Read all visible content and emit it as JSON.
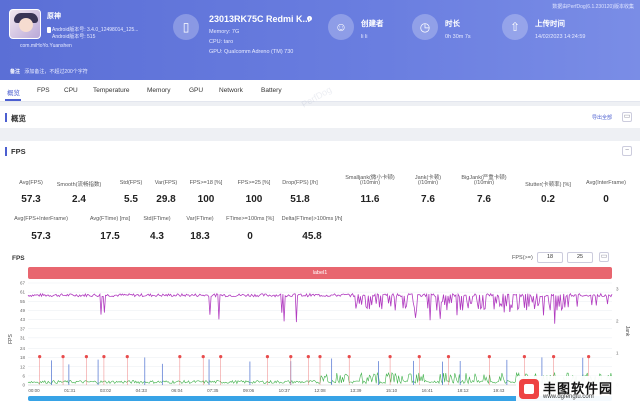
{
  "header": {
    "note": "数据由PerfDog(6.1.230120)版本收集",
    "app": {
      "name": "原神",
      "android_line1": "Android版本号: 3.4.0_12498014_125...",
      "android_line2": "Android版本号: 515",
      "package": "com.miHoYo.Yuanshen"
    },
    "remark_label": "备注",
    "remark_placeholder": "添加备注，不超过200个字符",
    "device": {
      "name": "23013RK75C Redmi K...",
      "memory": "Memory: 7G",
      "cpu": "CPU: taro",
      "gpu": "GPU: Qualcomm Adreno (TM) 730"
    },
    "creator": {
      "title": "创建者",
      "value": "li li"
    },
    "duration": {
      "title": "时长",
      "value": "0h 30m 7s"
    },
    "upload": {
      "title": "上传时间",
      "value": "14/02/2023 14:24:59"
    },
    "icons": {
      "phone": "phone-icon",
      "user": "user-icon",
      "clock": "clock-icon",
      "upload": "upload-icon"
    }
  },
  "tabs": [
    "概览",
    "FPS",
    "CPU",
    "Temperature",
    "Memory",
    "GPU",
    "Network",
    "Battery"
  ],
  "overview": {
    "title": "概览",
    "export": "导出全部"
  },
  "fps": {
    "title": "FPS",
    "stats_row1": [
      {
        "label": "Avg(FPS)",
        "value": "57.3"
      },
      {
        "label": "Smooth(流畅指数)",
        "value": "2.4"
      },
      {
        "label": "Std(FPS)",
        "value": "5.5"
      },
      {
        "label": "Var(FPS)",
        "value": "29.8"
      },
      {
        "label": "FPS>=18 [%]",
        "value": "100"
      },
      {
        "label": "FPS>=25 [%]",
        "value": "100"
      },
      {
        "label": "Drop(FPS) [/h]",
        "value": "51.8"
      },
      {
        "label": "Smalljank(微小卡顿)",
        "label2": "(/10min)",
        "value": "11.6"
      },
      {
        "label": "Jank(卡顿)",
        "label2": "(/10min)",
        "value": "7.6"
      },
      {
        "label": "BigJank(严重卡顿)",
        "label2": "(/10min)",
        "value": "7.6"
      },
      {
        "label": "Stutter(卡顿率) [%]",
        "value": "0.2"
      },
      {
        "label": "Avg(InterFrame)",
        "value": "0"
      }
    ],
    "stats_row2": [
      {
        "label": "Avg(FPS+InterFrame)",
        "value": "57.3"
      },
      {
        "label": "Avg(FTime) [ms]",
        "value": "17.5"
      },
      {
        "label": "Std(FTime)",
        "value": "4.3"
      },
      {
        "label": "Var(FTime)",
        "value": "18.3"
      },
      {
        "label": "FTime>=100ms [%]",
        "value": "0"
      },
      {
        "label": "Delta(FTime)>100ms [/h]",
        "value": "45.8"
      }
    ]
  },
  "chart": {
    "title": "FPS",
    "threshold_label": "FPS(>=)",
    "threshold1": "18",
    "threshold2": "25",
    "label_bar": "label1",
    "y_label_left": "FPS",
    "y_label_right": "Jank",
    "y_ticks_left": [
      "67",
      "61",
      "55",
      "49",
      "43",
      "37",
      "31",
      "24",
      "18",
      "12",
      "6",
      "0"
    ],
    "y_ticks_right": [
      "3",
      "2",
      "1",
      "0"
    ],
    "x_ticks": [
      "00:00",
      "01:31",
      "03:02",
      "04:33",
      "06:04",
      "07:35",
      "09:06",
      "10:37",
      "12:08",
      "13:39",
      "15:10",
      "16:41",
      "18:12",
      "19:43",
      "21:14",
      "22:45",
      "24:1"
    ]
  },
  "chart_data": {
    "type": "line",
    "ylim": [
      0,
      67
    ],
    "y2lim": [
      0,
      3
    ],
    "series": [
      {
        "name": "FPS",
        "color": "#b13cc0"
      },
      {
        "name": "Jank",
        "color": "#4a6fd0"
      },
      {
        "name": "BigJank",
        "color": "#e84c4c"
      }
    ]
  },
  "logo": {
    "text": "丰图软件园",
    "url": "www.dgfengtu.com"
  }
}
